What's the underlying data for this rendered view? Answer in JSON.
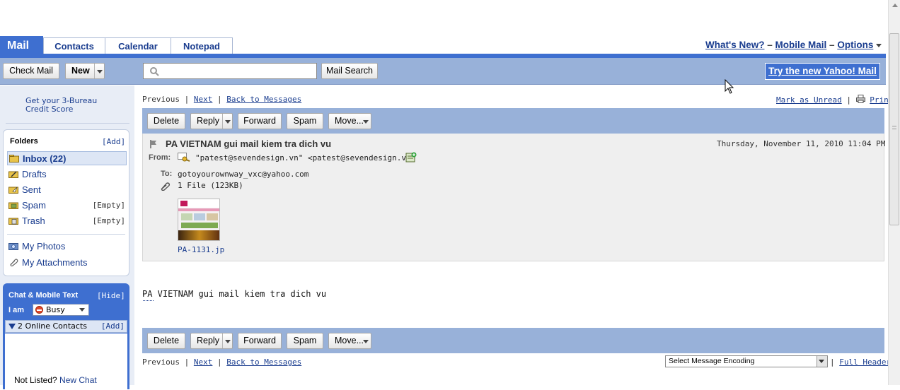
{
  "tabs": [
    {
      "label": "Mail"
    },
    {
      "label": "Contacts"
    },
    {
      "label": "Calendar"
    },
    {
      "label": "Notepad"
    }
  ],
  "top_links": {
    "whats_new": "What's New?",
    "mobile_mail": "Mobile Mail",
    "options": "Options",
    "sep": "–"
  },
  "toolbar": {
    "check_mail": "Check Mail",
    "new": "New",
    "search_placeholder": "",
    "mail_search": "Mail Search",
    "try_new": "Try the new Yahoo! Mail"
  },
  "ad": {
    "line1": "Get your 3-Bureau",
    "line2": "Credit Score"
  },
  "folders": {
    "title": "Folders",
    "add": "[Add]",
    "items": [
      {
        "label": "Inbox (22)",
        "empty": ""
      },
      {
        "label": "Drafts",
        "empty": ""
      },
      {
        "label": "Sent",
        "empty": ""
      },
      {
        "label": "Spam",
        "empty": "[Empty]"
      },
      {
        "label": "Trash",
        "empty": "[Empty]"
      }
    ],
    "my_photos": "My Photos",
    "my_attachments": "My Attachments"
  },
  "chat": {
    "title": "Chat & Mobile Text",
    "hide": "[Hide]",
    "i_am": "I am",
    "status": "Busy",
    "online": "2 Online Contacts",
    "add": "[Add]",
    "not_listed": "Not Listed?",
    "new_chat": "New Chat"
  },
  "nav": {
    "previous": "Previous",
    "sep": "|",
    "next": "Next",
    "back": "Back to Messages",
    "mark_unread": "Mark as Unread",
    "print": "Print"
  },
  "actions": {
    "delete": "Delete",
    "reply": "Reply",
    "forward": "Forward",
    "spam": "Spam",
    "move": "Move..."
  },
  "message": {
    "subject": "PA VIETNAM gui mail kiem tra dich vu",
    "date": "Thursday, November 11, 2010 11:04 PM",
    "from_label": "From:",
    "from": "\"patest@sevendesign.vn\" <patest@sevendesign.vn>",
    "to_label": "To:",
    "to": "gotoyourownway_vxc@yahoo.com",
    "files": "1 File (123KB)",
    "attachment_name": "PA-1131.jp",
    "body": "PA VIETNAM gui mail kiem tra dich vu"
  },
  "footer": {
    "encoding": "Select Message Encoding",
    "full_headers": "Full Headers"
  },
  "colors": {
    "header_bar": "#98b1d9",
    "accent_bar": "#3e6fd0",
    "link": "#1a3d8f",
    "chat_bg": "#3e6fd0"
  }
}
